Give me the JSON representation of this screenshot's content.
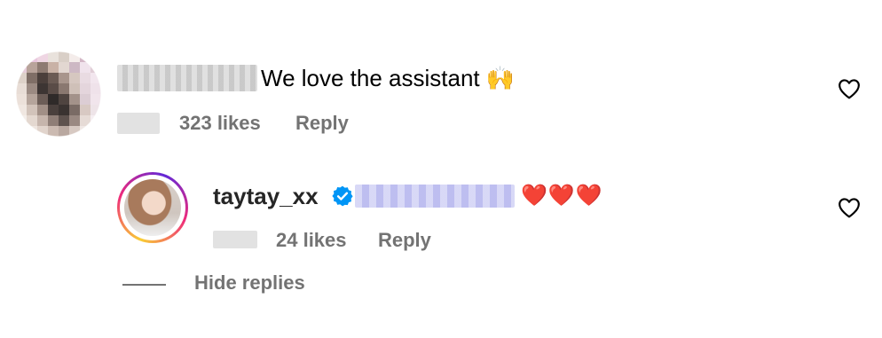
{
  "comment": {
    "text": "We love the assistant",
    "emoji": "🙌",
    "likes": "323 likes",
    "reply_label": "Reply"
  },
  "reply": {
    "username": "taytay_xx",
    "hearts": "❤️❤️❤️",
    "likes": "24 likes",
    "reply_label": "Reply"
  },
  "thread": {
    "hide_replies": "Hide replies"
  },
  "colors": {
    "meta_gray": "#737373",
    "verified_blue": "#0095f6",
    "heart_red": "#e0245e"
  },
  "icons": [
    "heart-outline-icon",
    "verified-badge-icon"
  ]
}
